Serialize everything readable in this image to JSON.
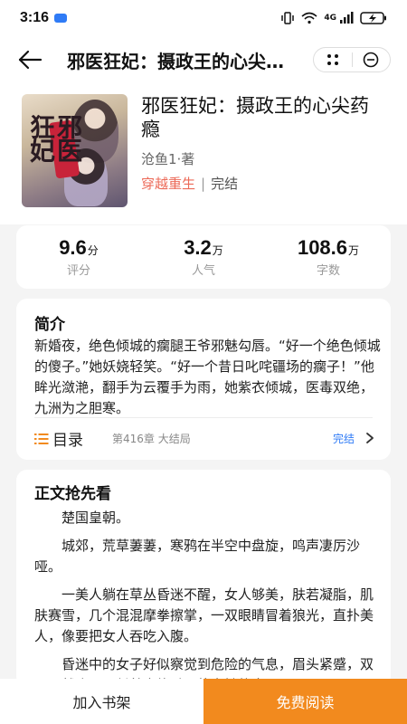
{
  "status_bar": {
    "time": "3:16",
    "network": "4G",
    "battery_charging": true
  },
  "nav": {
    "title": "邪医狂妃：摄政王的心尖药瘾",
    "back_icon": "back-arrow-icon",
    "more_icon": "more-dots-icon",
    "close_icon": "close-circle-icon"
  },
  "book": {
    "title": "邪医狂妃：摄政王的心尖药瘾",
    "author": "沧鱼1·著",
    "genre": "穿越重生",
    "separator": "|",
    "status": "完结"
  },
  "stats": [
    {
      "value": "9.6",
      "unit": "分",
      "label": "评分"
    },
    {
      "value": "3.2",
      "unit": "万",
      "label": "人气"
    },
    {
      "value": "108.6",
      "unit": "万",
      "label": "字数"
    }
  ],
  "intro": {
    "heading": "简介",
    "text": "新婚夜，绝色倾城的瘸腿王爷邪魅勾唇。“好一个绝色倾城的傻子。”她妖娆轻笑。“好一个昔日叱咤疆场的瘸子！”他眸光潋滟，翻手为云覆手为雨，她紫衣倾城，医毒双绝，九洲为之胆寒。"
  },
  "toc": {
    "label": "目录",
    "latest": "第416章 大结局",
    "status": "完结"
  },
  "content": {
    "heading": "正文抢先看",
    "paragraphs": [
      "楚国皇朝。",
      "城郊，荒草萋萋，寒鸦在半空中盘旋，鸣声凄厉沙哑。",
      "一美人躺在草丛昏迷不醒，女人够美，肤若凝脂，肌肤赛雪，几个混混摩拳擦掌，一双眼睛冒着狼光，直扑美人，像要把女人吞吃入腹。",
      "昏迷中的女子好似察觉到危险的气息，眉头紧蹙，双眼骤然睁开，凭着本能避开扑向她的大"
    ]
  },
  "bottom": {
    "shelf_label": "加入书架",
    "read_label": "免费阅读"
  },
  "colors": {
    "accent": "#f28a1e",
    "genre": "#ec6a58",
    "link": "#2f7bf6"
  }
}
